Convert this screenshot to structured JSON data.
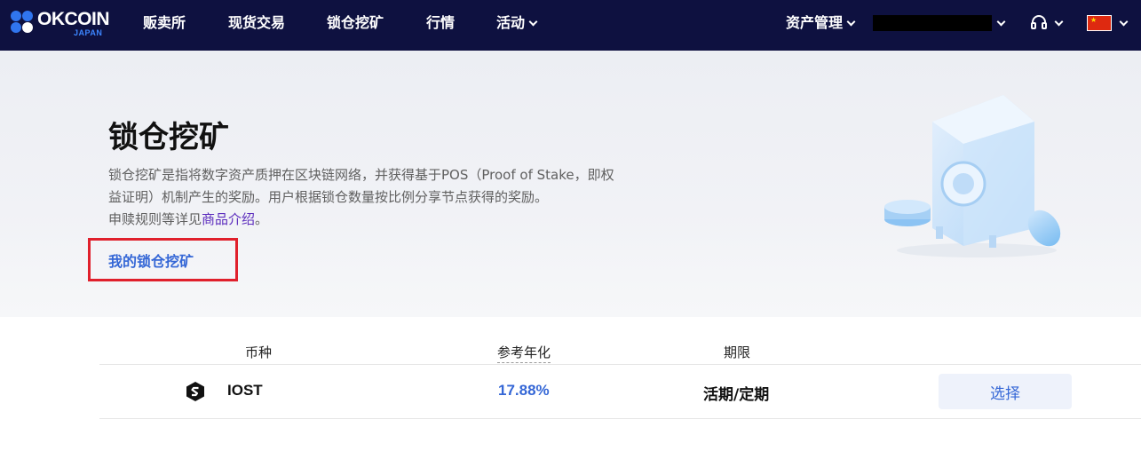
{
  "brand": {
    "name": "OKCOIN",
    "sub": "JAPAN"
  },
  "nav": {
    "items": [
      "贩卖所",
      "现货交易",
      "锁仓挖矿",
      "行情",
      "活动"
    ],
    "asset_mgmt": "资产管理"
  },
  "hero": {
    "title": "锁仓挖矿",
    "desc_line1": "锁仓挖矿是指将数字资产质押在区块链网络，并获得基于POS（Proof of Stake，即权",
    "desc_line2": "益证明）机制产生的奖励。用户根据锁仓数量按比例分享节点获得的奖励。",
    "desc_line3_prefix": "申赎规则等详见",
    "desc_link": "商品介绍",
    "desc_line3_suffix": "。",
    "my_mining": "我的锁仓挖矿"
  },
  "table": {
    "headers": {
      "coin": "币种",
      "apy": "参考年化",
      "term": "期限"
    },
    "rows": [
      {
        "coin": "IOST",
        "apy": "17.88%",
        "term": "活期/定期",
        "action": "选择"
      }
    ]
  },
  "colors": {
    "nav_bg": "#0e1140",
    "accent_blue": "#3567d6",
    "highlight_red": "#e0202c"
  }
}
